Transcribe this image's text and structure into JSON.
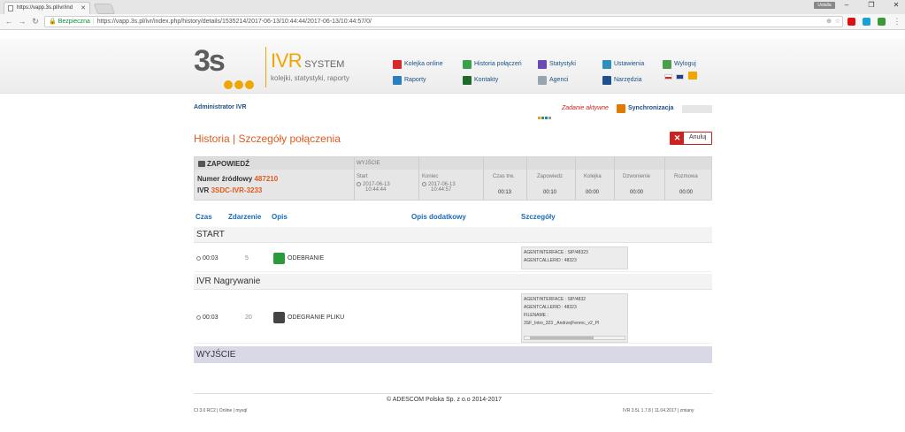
{
  "browser": {
    "tab_title": "https://vapp.3s.pl/ivr/ind",
    "user_badge": "Ustalla",
    "secure_label": "Bezpieczna",
    "url": "https://vapp.3s.pl/ivr/index.php/history/details/1535214/2017-06-13/10:44:44/2017-06-13/10:44:57/0/"
  },
  "header": {
    "logo_text": "3s",
    "brand_ivr": "IVR",
    "brand_system": "SYSTEM",
    "tagline": "kolejki, statystyki, raporty"
  },
  "menu": {
    "queue_online": "Kolejka online",
    "call_history": "Historia połączeń",
    "statistics": "Statystyki",
    "settings": "Ustawienia",
    "logout": "Wyloguj",
    "reports": "Raporty",
    "contacts": "Kontakty",
    "agents": "Agenci",
    "tools": "Narzędzia"
  },
  "admin": {
    "user": "Administrator IVR",
    "task_status": "Zadanie aktywne",
    "sync": "Synchronizacja"
  },
  "page": {
    "title": "Historia | Szczegóły połączenia",
    "cancel": "Anuluj"
  },
  "summary": {
    "section": "ZAPOWIEDŹ",
    "exit_label": "WYJŚCIE",
    "src_label": "Numer źródłowy",
    "src_value": "487210",
    "ivr_label": "IVR",
    "ivr_value": "3SDC-IVR-3233",
    "start_label": "Start",
    "start_date": "2017-06-13",
    "start_time": "10:44:44",
    "end_label": "Koniec",
    "end_date": "2017-06-13",
    "end_time": "10:44:57",
    "dur_label": "Czas trw.",
    "dur_value": "00:13",
    "ann_label": "Zapowiedz",
    "ann_value": "00:10",
    "queue_label": "Kolejka",
    "queue_value": "00:00",
    "ring_label": "Dzwonienie",
    "ring_value": "00:00",
    "talk_label": "Rozmowa",
    "talk_value": "00:00"
  },
  "columns": {
    "time": "Czas",
    "event": "Zdarzenie",
    "desc": "Opis",
    "extra": "Opis dodatkowy",
    "details": "Szczegóły"
  },
  "sections": {
    "start": "START",
    "nagrywanie": "IVR Nagrywanie",
    "exit": "WYJŚCIE"
  },
  "rows": [
    {
      "time": "00:03",
      "event": "5",
      "label": "ODEBRANIE",
      "details": [
        "AGENTINTERFACE : SIP/48323",
        "AGENTCALLERID : 48323"
      ]
    },
    {
      "time": "00:03",
      "event": "20",
      "label": "ODEGRANIE PLIKU",
      "details": [
        "AGENTINTERFACE : SIP/4832",
        "AGENTCALLERID : 48323",
        "FILENAME :",
        "3SF_Intro_323        _AndrzejFerenc_v2_Pl"
      ]
    }
  ],
  "footer": {
    "copyright": "© ADESCOM Polska Sp. z o.o   2014-2017",
    "ver_left": "CI 3.0 RC2 | Online | mysql",
    "ver_right": "IVR 3.5L 1.7.8 | 11.04.2017 | zmiany"
  }
}
